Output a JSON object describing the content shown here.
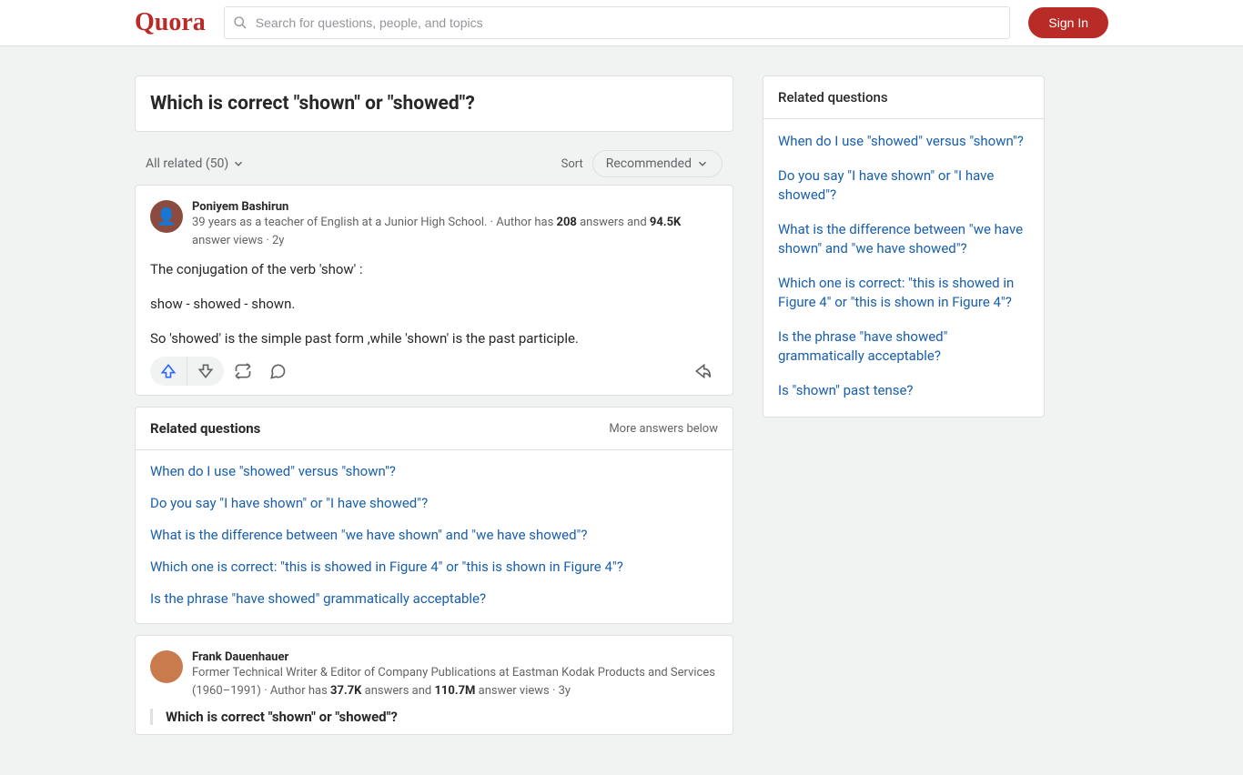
{
  "header": {
    "logo": "Quora",
    "search_placeholder": "Search for questions, people, and topics",
    "sign_in": "Sign In"
  },
  "question": {
    "title": "Which is correct \"shown\" or \"showed\"?"
  },
  "filters": {
    "all_related": "All related (50)",
    "sort_label": "Sort",
    "sort_value": "Recommended"
  },
  "answers": [
    {
      "author": "Poniyem Bashirun",
      "bio": "39 years as a teacher of English at a Junior High School.",
      "answers_count": "208",
      "views": "94.5K",
      "meta_prefix": " · Author has ",
      "meta_mid": " answers and ",
      "meta_suffix": " answer views",
      "time": "2y",
      "paragraphs": [
        "The conjugation of the verb 'show' :",
        "show - showed - shown.",
        "So 'showed' is the simple past form ,while 'shown' is the past participle."
      ]
    },
    {
      "author": "Frank Dauenhauer",
      "bio": "Former Technical Writer & Editor of Company Publications at Eastman Kodak Products and Services (1960–1991)",
      "answers_count": "37.7K",
      "views": "110.7M",
      "meta_prefix": " · Author has ",
      "meta_mid": " answers and ",
      "meta_suffix": " answer views",
      "time": "3y",
      "quoted": "Which is correct \"shown\" or \"showed\"?"
    }
  ],
  "related_inline": {
    "title": "Related questions",
    "more": "More answers below",
    "links": [
      "When do I use \"showed\" versus \"shown\"?",
      "Do you say \"I have shown\" or \"I have showed\"?",
      "What is the difference between \"we have shown\" and \"we have showed\"?",
      "Which one is correct: \"this is showed in Figure 4\" or \"this is shown in Figure 4\"?",
      "Is the phrase \"have showed\" grammatically acceptable?"
    ]
  },
  "sidebar": {
    "title": "Related questions",
    "links": [
      "When do I use \"showed\" versus \"shown\"?",
      "Do you say \"I have shown\" or \"I have showed\"?",
      "What is the difference between \"we have shown\" and \"we have showed\"?",
      "Which one is correct: \"this is showed in Figure 4\" or \"this is shown in Figure 4\"?",
      "Is the phrase \"have showed\" grammatically acceptable?",
      "Is \"shown\" past tense?"
    ]
  }
}
